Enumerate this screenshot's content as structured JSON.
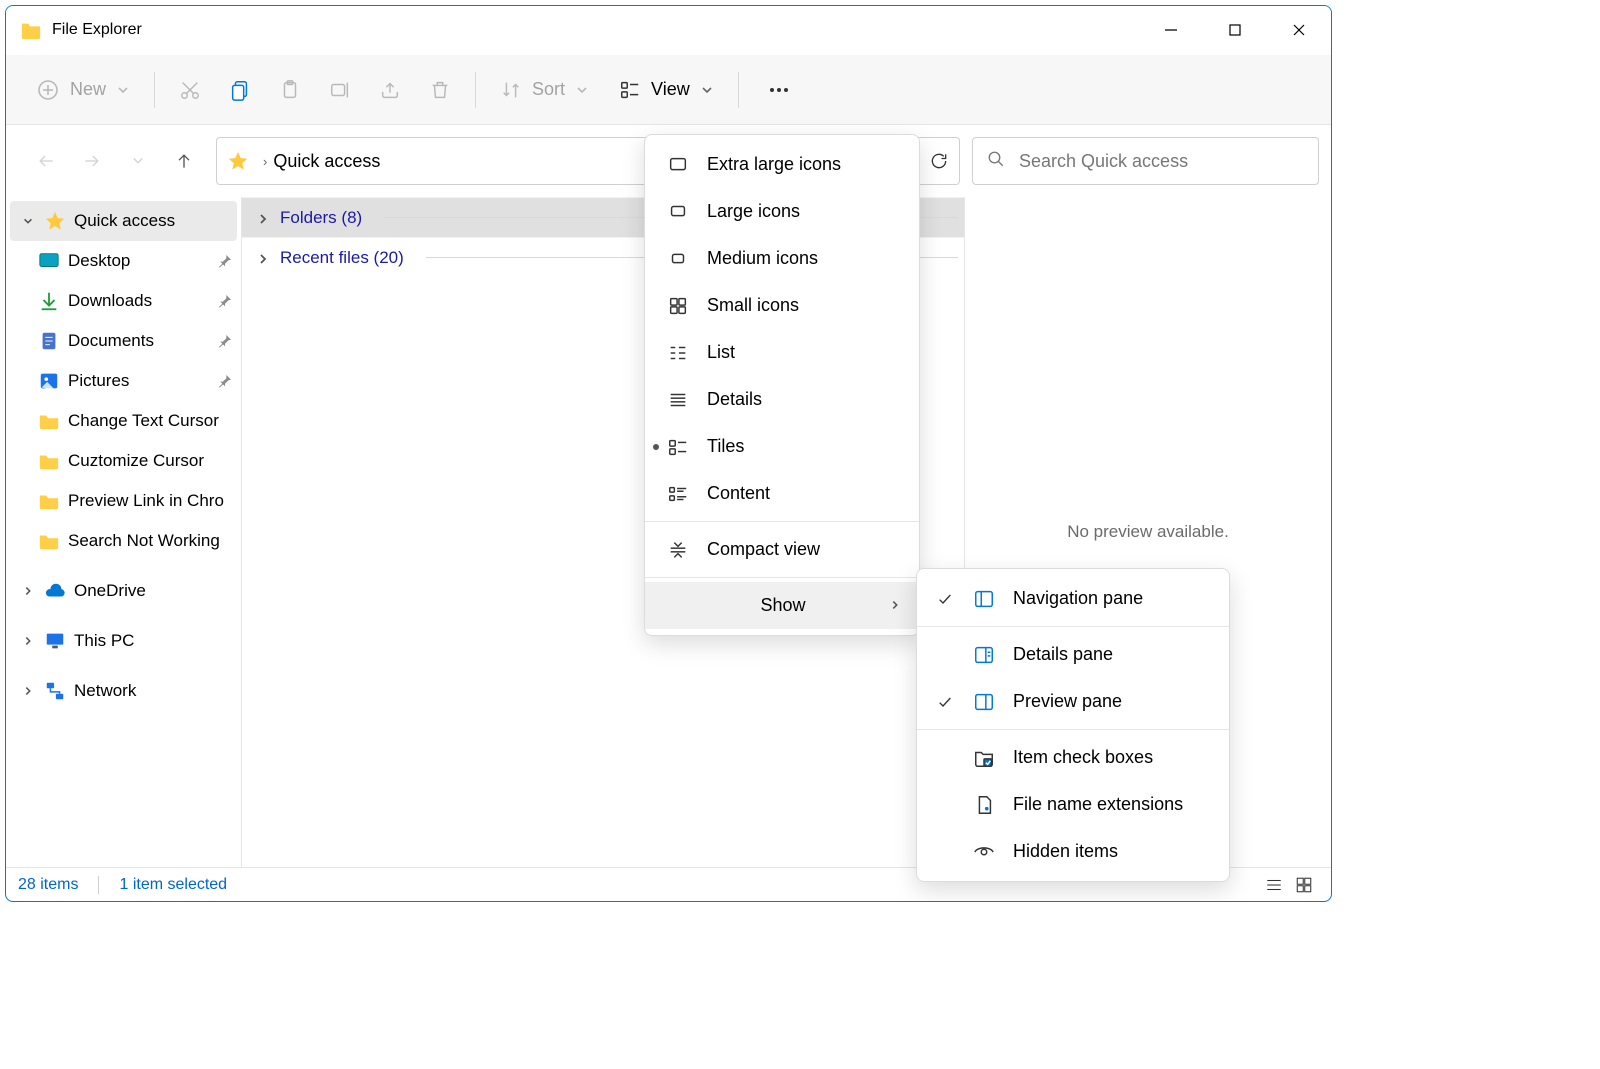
{
  "window": {
    "title": "File Explorer"
  },
  "toolbar": {
    "new_label": "New",
    "sort_label": "Sort",
    "view_label": "View"
  },
  "address": {
    "location": "Quick access"
  },
  "search": {
    "placeholder": "Search Quick access"
  },
  "sidebar": {
    "quick_access": "Quick access",
    "items": [
      {
        "label": "Desktop",
        "pinned": true
      },
      {
        "label": "Downloads",
        "pinned": true
      },
      {
        "label": "Documents",
        "pinned": true
      },
      {
        "label": "Pictures",
        "pinned": true
      },
      {
        "label": "Change Text Cursor",
        "pinned": false
      },
      {
        "label": "Cuztomize Cursor",
        "pinned": false
      },
      {
        "label": "Preview Link in Chro",
        "pinned": false
      },
      {
        "label": "Search Not Working",
        "pinned": false
      }
    ],
    "onedrive": "OneDrive",
    "this_pc": "This PC",
    "network": "Network"
  },
  "content": {
    "group_folders": "Folders (8)",
    "group_recent": "Recent files (20)"
  },
  "preview": {
    "message": "No preview available."
  },
  "status": {
    "count": "28 items",
    "selected": "1 item selected"
  },
  "view_menu": {
    "items": [
      "Extra large icons",
      "Large icons",
      "Medium icons",
      "Small icons",
      "List",
      "Details",
      "Tiles",
      "Content"
    ],
    "compact": "Compact view",
    "show": "Show"
  },
  "show_submenu": {
    "navigation_pane": "Navigation pane",
    "details_pane": "Details pane",
    "preview_pane": "Preview pane",
    "item_checkboxes": "Item check boxes",
    "file_ext": "File name extensions",
    "hidden": "Hidden items"
  }
}
